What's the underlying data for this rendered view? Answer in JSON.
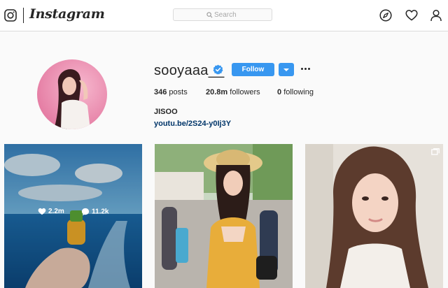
{
  "nav": {
    "brand": "Instagram",
    "search_placeholder": "Search",
    "icons": [
      "instagram-camera-icon",
      "compass-icon",
      "heart-icon",
      "profile-icon"
    ]
  },
  "profile": {
    "username": "sooyaaa__",
    "verified": true,
    "follow_label": "Follow",
    "posts": {
      "value": "346",
      "label": "posts"
    },
    "followers": {
      "value": "20.8m",
      "label": "followers"
    },
    "following": {
      "value": "0",
      "label": "following"
    },
    "full_name": "JISOO",
    "link": "youtu.be/2S24-y0Ij3Y"
  },
  "posts": [
    {
      "likes": "2.2m",
      "comments": "11.2k",
      "hovered": true
    },
    {
      "hovered": false
    },
    {
      "hovered": false,
      "badge": "carousel-icon"
    }
  ],
  "colors": {
    "accent": "#3897f0",
    "link": "#003569",
    "border": "#dbdbdb"
  }
}
